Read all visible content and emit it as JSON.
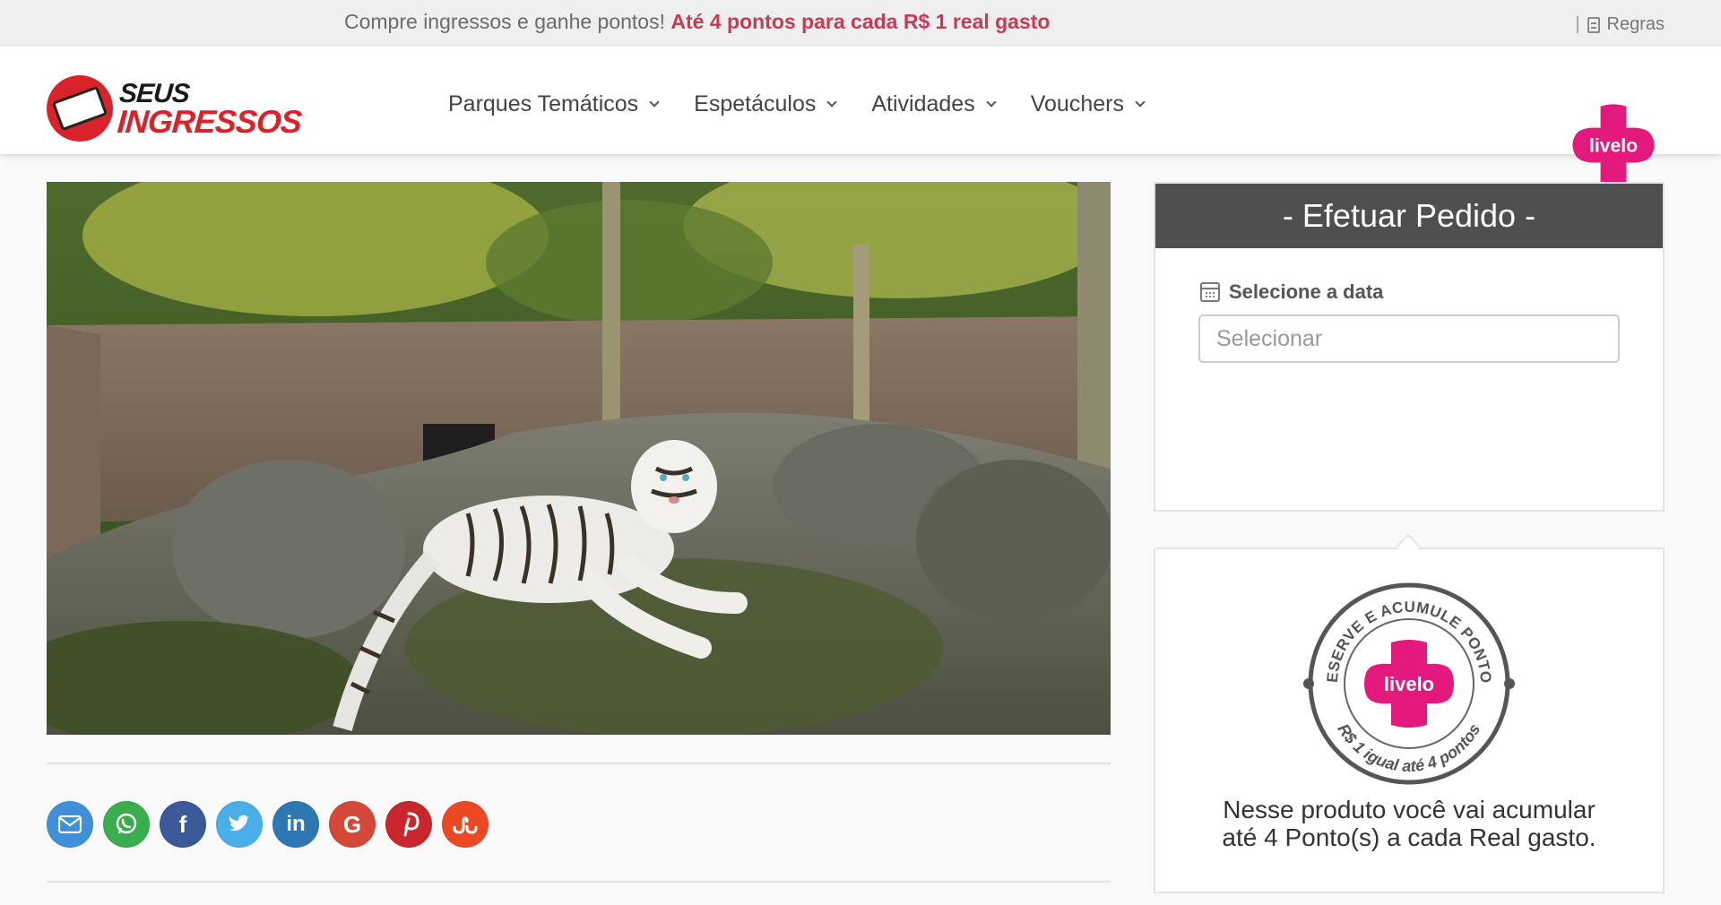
{
  "promo": {
    "text": "Compre ingressos e ganhe pontos!",
    "highlight": "Até 4 pontos para cada R$ 1 real gasto",
    "separator": "|",
    "rules_label": "Regras"
  },
  "brand": {
    "logo_top": "SEUS",
    "logo_bottom": "INGRESSOS",
    "partner_logo_text": "livelo",
    "accent_color": "#d9232b",
    "livelo_color": "#e4197d"
  },
  "nav": {
    "items": [
      {
        "label": "Parques Temáticos"
      },
      {
        "label": "Espetáculos"
      },
      {
        "label": "Atividades"
      },
      {
        "label": "Vouchers"
      }
    ]
  },
  "share": {
    "buttons": [
      {
        "name": "email",
        "glyph": "✉",
        "color": "#3f8fd9"
      },
      {
        "name": "whatsapp",
        "glyph": "✆",
        "color": "#3aae4f"
      },
      {
        "name": "facebook",
        "glyph": "f",
        "color": "#3b5998"
      },
      {
        "name": "twitter",
        "glyph": "🐦",
        "color": "#4aaee8"
      },
      {
        "name": "linkedin",
        "glyph": "in",
        "color": "#2d77b2"
      },
      {
        "name": "google",
        "glyph": "G",
        "color": "#d34836"
      },
      {
        "name": "pinterest",
        "glyph": "P",
        "color": "#c9252c"
      },
      {
        "name": "stumbleupon",
        "glyph": "su",
        "color": "#eb4924"
      }
    ]
  },
  "order": {
    "title": "- Efetuar Pedido -",
    "date_label": "Selecione a data",
    "date_placeholder": "Selecionar"
  },
  "points": {
    "badge_top_text": "RESERVE E ACUMULE PONTOS",
    "badge_bottom_text": "R$ 1 igual até 4 pontos",
    "badge_center": "livelo",
    "message_line1": "Nesse produto você vai acumular",
    "message_line2": "até 4 Ponto(s) a cada Real gasto."
  }
}
